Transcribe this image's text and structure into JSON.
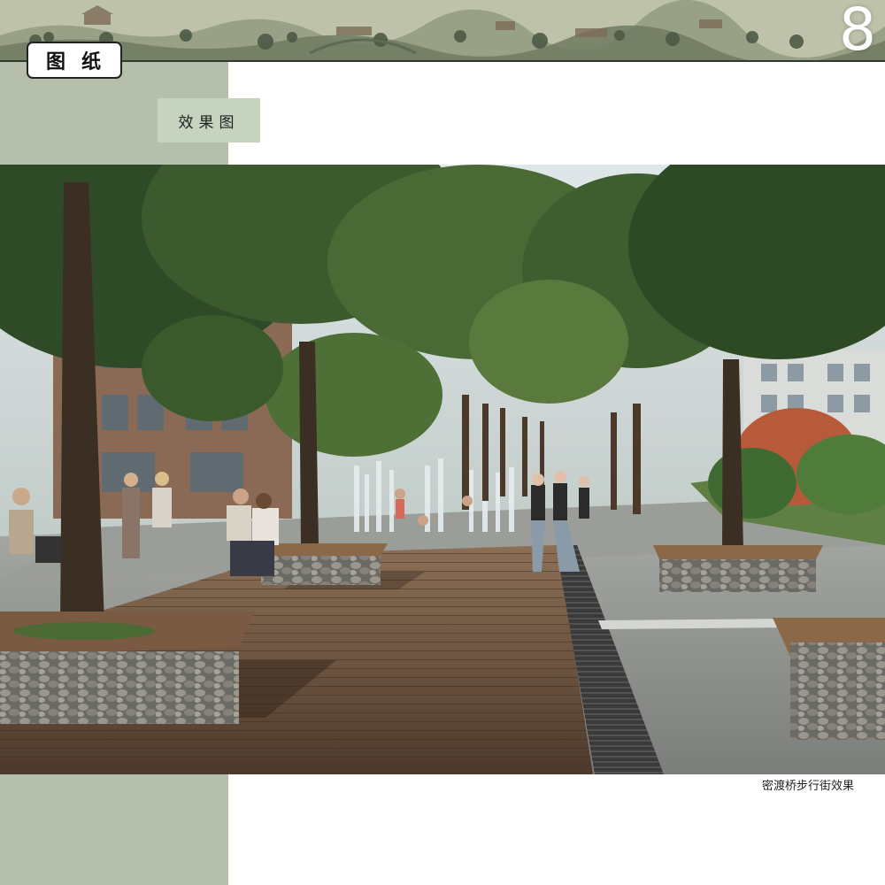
{
  "header": {
    "page_number": "8",
    "drawing_label": "图纸"
  },
  "section": {
    "title": "效果图"
  },
  "render": {
    "caption": "密渡桥步行街效果"
  },
  "colors": {
    "side_panel": "#b5bfac",
    "section_tag": "#c6d3bf",
    "banner": "#b9bca4"
  }
}
